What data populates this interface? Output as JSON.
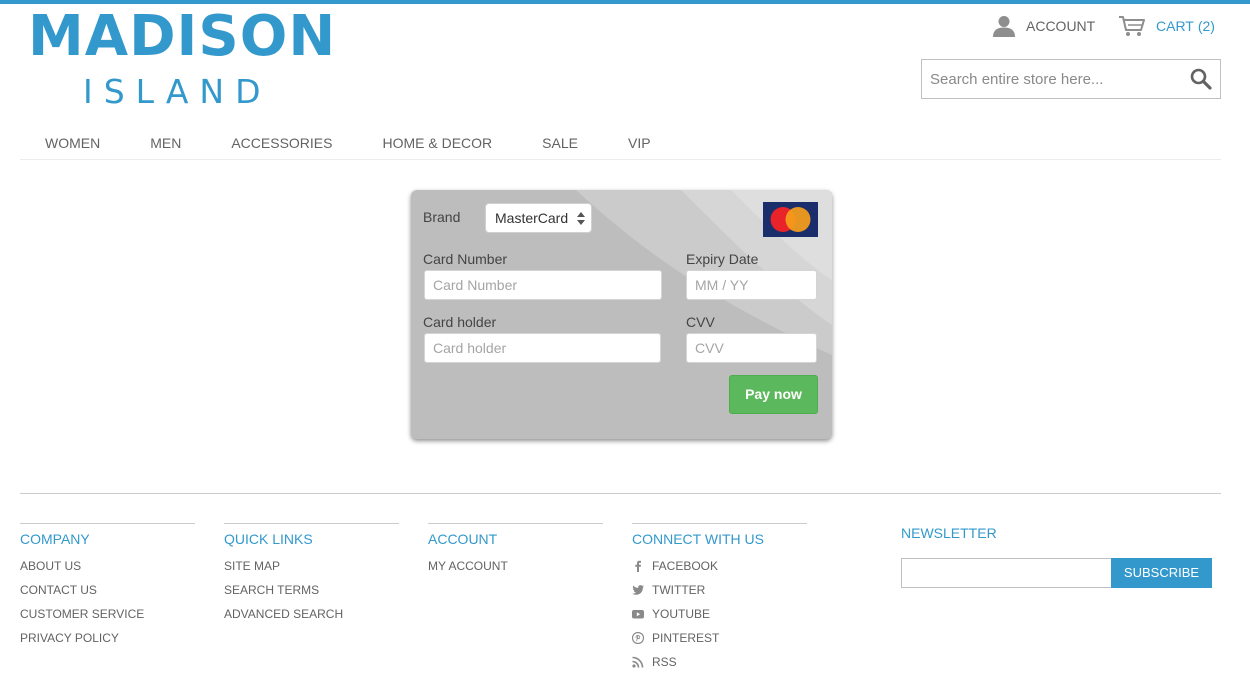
{
  "header": {
    "logo_main": "MADISON",
    "logo_sub": "ISLAND",
    "account_label": "ACCOUNT",
    "cart_label": "CART",
    "cart_count": "(2)",
    "search_placeholder": "Search entire store here...",
    "accent_color": "#3399cc"
  },
  "nav": {
    "items": [
      "WOMEN",
      "MEN",
      "ACCESSORIES",
      "HOME & DECOR",
      "SALE",
      "VIP"
    ]
  },
  "payment_form": {
    "brand_label": "Brand",
    "brand_value": "MasterCard",
    "card_number_label": "Card Number",
    "card_number_placeholder": "Card Number",
    "expiry_label": "Expiry Date",
    "expiry_placeholder": "MM / YY",
    "holder_label": "Card holder",
    "holder_placeholder": "Card holder",
    "cvv_label": "CVV",
    "cvv_placeholder": "CVV",
    "pay_button": "Pay now",
    "card_logo_text": "MasterCard",
    "pay_button_color": "#5cb85c"
  },
  "footer": {
    "company": {
      "title": "COMPANY",
      "links": [
        "ABOUT US",
        "CONTACT US",
        "CUSTOMER SERVICE",
        "PRIVACY POLICY"
      ]
    },
    "quick_links": {
      "title": "QUICK LINKS",
      "links": [
        "SITE MAP",
        "SEARCH TERMS",
        "ADVANCED SEARCH"
      ]
    },
    "account": {
      "title": "ACCOUNT",
      "links": [
        "MY ACCOUNT"
      ]
    },
    "connect": {
      "title": "CONNECT WITH US",
      "links": [
        {
          "label": "FACEBOOK",
          "icon": "facebook-icon"
        },
        {
          "label": "TWITTER",
          "icon": "twitter-icon"
        },
        {
          "label": "YOUTUBE",
          "icon": "youtube-icon"
        },
        {
          "label": "PINTEREST",
          "icon": "pinterest-icon"
        },
        {
          "label": "RSS",
          "icon": "rss-icon"
        }
      ]
    },
    "newsletter": {
      "title": "NEWSLETTER",
      "subscribe_label": "SUBSCRIBE"
    }
  }
}
